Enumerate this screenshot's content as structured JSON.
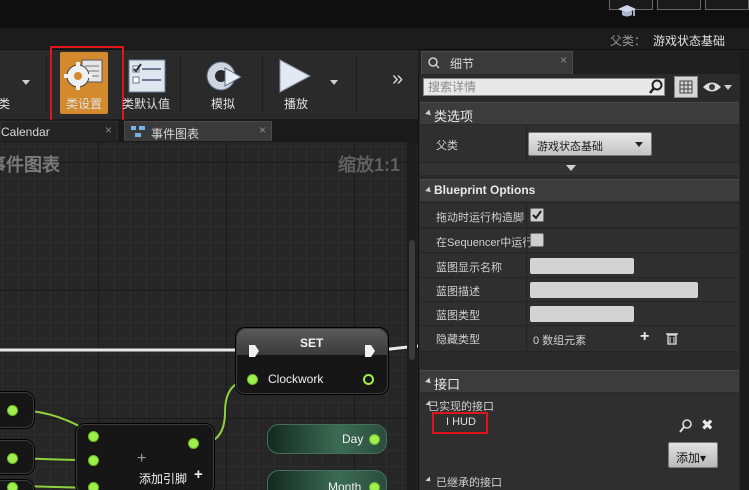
{
  "window": {
    "parent_label": "父类：",
    "parent_value": "游戏状态基础"
  },
  "toolbar": {
    "items": [
      {
        "label": "类"
      },
      {
        "label": "类设置",
        "highlighted": true
      },
      {
        "label": "类默认值"
      },
      {
        "label": "模拟"
      },
      {
        "label": "播放"
      }
    ],
    "overflow": "»"
  },
  "tabs": [
    {
      "label": "Calendar"
    },
    {
      "label": "事件图表"
    }
  ],
  "graph": {
    "title": "事件图表",
    "zoom": "缩放1:1",
    "nodes": {
      "set": {
        "title": "SET",
        "var": "Clockwork"
      },
      "add_pin": {
        "label": "添加引脚"
      },
      "day": {
        "label": "Day"
      },
      "month": {
        "label": "Month"
      }
    }
  },
  "details": {
    "tab_label": "细节",
    "search_placeholder": "搜索详情",
    "class_options": {
      "header": "类选项",
      "parent_label": "父类",
      "parent_value": "游戏状态基础"
    },
    "blueprint_options": {
      "header": "Blueprint Options",
      "rows": [
        {
          "label": "拖动时运行构造脚",
          "checked": true
        },
        {
          "label": "在Sequencer中运行",
          "checked": false
        },
        {
          "label": "蓝图显示名称",
          "value": ""
        },
        {
          "label": "蓝图描述",
          "value": ""
        },
        {
          "label": "蓝图类型",
          "value": ""
        }
      ],
      "hidden_cats_label": "隐藏类型",
      "hidden_cats_value": "0 数组元素"
    },
    "interfaces": {
      "header": "接口",
      "implemented_label": "已实现的接口",
      "implemented_item": "I HUD",
      "add_button": "添加▾",
      "inherited_label": "已继承的接口"
    }
  },
  "colors": {
    "highlight": "#e0141d",
    "class_settings_bg": "#d38a2e",
    "pin_green": "#9ff04a"
  }
}
